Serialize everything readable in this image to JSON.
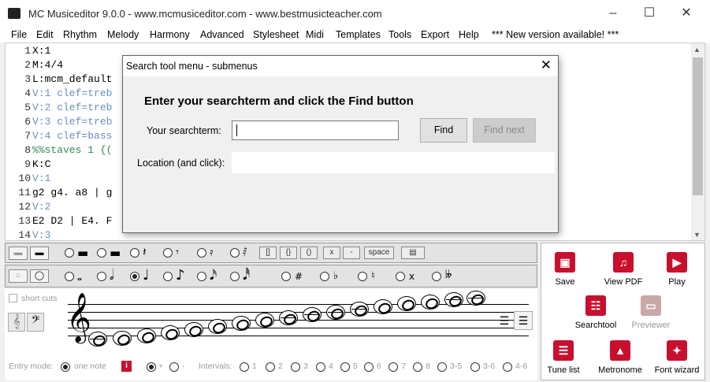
{
  "window": {
    "title": "MC Musiceditor 9.0.0 - www.mcmusiceditor.com - www.bestmusicteacher.com"
  },
  "menu": [
    "File",
    "Edit",
    "Rhythm",
    "Melody",
    "Harmony",
    "Advanced",
    "Stylesheet",
    "Midi",
    "Templates",
    "Tools",
    "Export",
    "Help",
    "*** New version available! ***"
  ],
  "editor": {
    "lines": [
      {
        "num": "1",
        "text": "X:1"
      },
      {
        "num": "2",
        "text": "M:4/4"
      },
      {
        "num": "3",
        "text": "L:mcm_default"
      },
      {
        "num": "4",
        "text": "V:1 clef=treb"
      },
      {
        "num": "5",
        "text": "V:2 clef=treb"
      },
      {
        "num": "6",
        "text": "V:3 clef=treb"
      },
      {
        "num": "7",
        "text": "V:4 clef=bass"
      },
      {
        "num": "8",
        "text": "%%staves 1 {("
      },
      {
        "num": "9",
        "text": "K:C"
      },
      {
        "num": "10",
        "text": "V:1"
      },
      {
        "num": "11",
        "text": "g2 g4. a8 | g"
      },
      {
        "num": "12",
        "text": "V:2"
      },
      {
        "num": "13",
        "text": "E2 D2 | E4. F"
      },
      {
        "num": "14",
        "text": "V:3"
      }
    ]
  },
  "dialog": {
    "title": "Search tool menu - submenus",
    "heading": "Enter your searchterm and click the Find button",
    "search_label": "Your searchterm:",
    "search_value": "",
    "find_button": "Find",
    "find_next_button": "Find next",
    "location_label": "Location (and click):",
    "location_value": ""
  },
  "toolbar": {
    "brackets": "[]",
    "braces": "{}",
    "parens": "()",
    "x": "x",
    "dash": "-",
    "space": "space",
    "accidentals": [
      "#",
      "♭",
      "♮",
      "x",
      "𝄫"
    ]
  },
  "entry": {
    "short_cuts": "short cuts",
    "entry_mode_label": "Entry mode:",
    "one_note": "one note",
    "info_icon": "i",
    "plus": "+",
    "minus": "-",
    "intervals_label": "Intervals:",
    "intervals": [
      "1",
      "2",
      "3",
      "4",
      "5",
      "6",
      "7",
      "8",
      "3-5",
      "3-6",
      "4-6"
    ]
  },
  "actions": {
    "save": "Save",
    "view_pdf": "View PDF",
    "play": "Play",
    "searchtool": "Searchtool",
    "previewer": "Previewer",
    "tune_list": "Tune list",
    "metronome": "Metronome",
    "font_wizard": "Font wizard"
  },
  "colors": {
    "accent": "#c8102e",
    "comment": "#6a8fbf",
    "green": "#2e8b57"
  }
}
